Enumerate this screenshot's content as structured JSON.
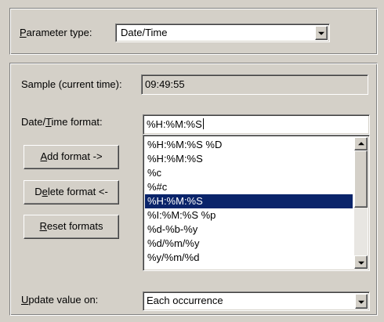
{
  "parameter_type": {
    "label_underlined": "P",
    "label_rest": "arameter type:",
    "value": "Date/Time"
  },
  "sample": {
    "label": "Sample (current time):",
    "value": "09:49:55"
  },
  "datetime_format": {
    "label_before": "Date/",
    "label_underlined": "T",
    "label_after": "ime format:",
    "value": "%H:%M:%S"
  },
  "buttons": {
    "add_underlined": "A",
    "add_rest": "dd format ->",
    "delete_before": "D",
    "delete_underlined": "e",
    "delete_rest": "lete format <-",
    "reset_underlined": "R",
    "reset_rest": "eset formats"
  },
  "format_list": {
    "items": [
      "%H:%M:%S %D",
      "%H:%M:%S",
      "%c",
      "%#c",
      "%H:%M:%S",
      "%I:%M:%S %p",
      "%d-%b-%y",
      "%d/%m/%y",
      "%y/%m/%d"
    ],
    "selected_index": 4
  },
  "update_value": {
    "label_underlined": "U",
    "label_rest": "pdate value on:",
    "value": "Each occurrence"
  },
  "icons": [
    "chevron-down-icon",
    "scroll-up-icon",
    "scroll-down-icon"
  ]
}
